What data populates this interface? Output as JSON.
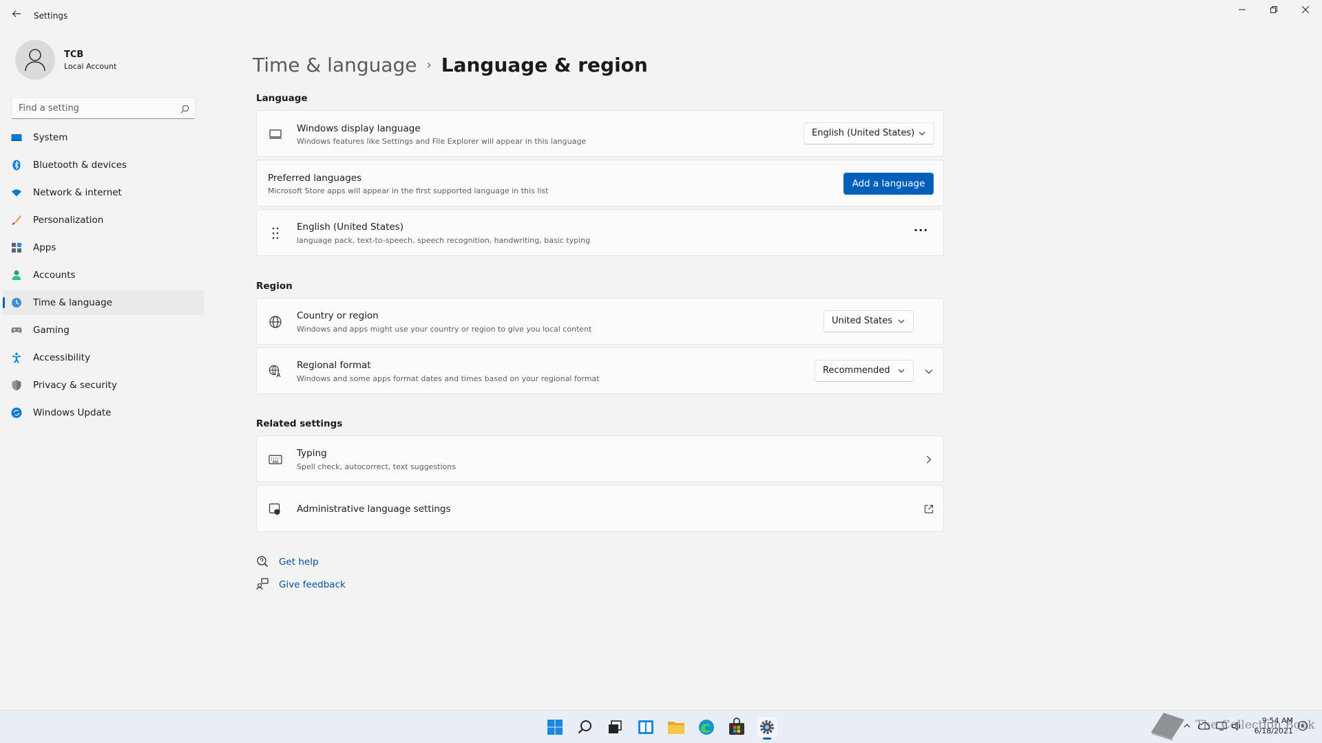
{
  "window": {
    "title": "Settings",
    "back_icon": "back-arrow-icon",
    "controls": [
      "minimize-icon",
      "restore-icon",
      "close-icon"
    ]
  },
  "profile": {
    "name": "TCB",
    "account_type": "Local Account",
    "avatar_icon": "person-icon"
  },
  "search": {
    "placeholder": "Find a setting",
    "value": "",
    "icon": "search-icon"
  },
  "sidebar": {
    "items": [
      {
        "label": "System",
        "icon": "system-icon",
        "active": false
      },
      {
        "label": "Bluetooth & devices",
        "icon": "bluetooth-icon",
        "active": false
      },
      {
        "label": "Network & internet",
        "icon": "wifi-icon",
        "active": false
      },
      {
        "label": "Personalization",
        "icon": "brush-icon",
        "active": false
      },
      {
        "label": "Apps",
        "icon": "apps-icon",
        "active": false
      },
      {
        "label": "Accounts",
        "icon": "accounts-icon",
        "active": false
      },
      {
        "label": "Time & language",
        "icon": "time-language-icon",
        "active": true
      },
      {
        "label": "Gaming",
        "icon": "gaming-icon",
        "active": false
      },
      {
        "label": "Accessibility",
        "icon": "accessibility-icon",
        "active": false
      },
      {
        "label": "Privacy & security",
        "icon": "shield-icon",
        "active": false
      },
      {
        "label": "Windows Update",
        "icon": "update-icon",
        "active": false
      }
    ]
  },
  "breadcrumb": {
    "parent": "Time & language",
    "separator": "›",
    "current": "Language & region"
  },
  "language": {
    "heading": "Language",
    "display_language": {
      "title": "Windows display language",
      "description": "Windows features like Settings and File Explorer will appear in this language",
      "value": "English (United States)",
      "icon": "monitor-icon"
    },
    "preferred": {
      "title": "Preferred languages",
      "description": "Microsoft Store apps will appear in the first supported language in this list",
      "button": "Add a language"
    },
    "installed": {
      "title": "English (United States)",
      "description": "language pack, text-to-speech, speech recognition, handwriting, basic typing",
      "more": "···",
      "icon": "drag-handle-icon"
    }
  },
  "region": {
    "heading": "Region",
    "country": {
      "title": "Country or region",
      "description": "Windows and apps might use your country or region to give you local content",
      "value": "United States",
      "icon": "globe-icon"
    },
    "format": {
      "title": "Regional format",
      "description": "Windows and some apps format dates and times based on your regional format",
      "value": "Recommended",
      "icon": "regional-format-icon"
    }
  },
  "related": {
    "heading": "Related settings",
    "typing": {
      "title": "Typing",
      "description": "Spell check, autocorrect, text suggestions",
      "icon": "keyboard-icon"
    },
    "admin": {
      "title": "Administrative language settings",
      "icon": "admin-shield-icon"
    }
  },
  "help": {
    "get_help": "Get help",
    "feedback": "Give feedback"
  },
  "taskbar": {
    "apps": [
      "start-icon",
      "search-icon",
      "task-view-icon",
      "widgets-icon",
      "file-explorer-icon",
      "edge-icon",
      "store-icon",
      "settings-icon"
    ],
    "active_app": "settings-icon",
    "time": "9:54 AM",
    "date": "6/18/2021"
  },
  "watermark": "The Collection Book",
  "colors": {
    "accent": "#005fb8",
    "background": "#f3f3f3",
    "card": "#fbfbfb",
    "taskbar": "#e9eef6"
  }
}
